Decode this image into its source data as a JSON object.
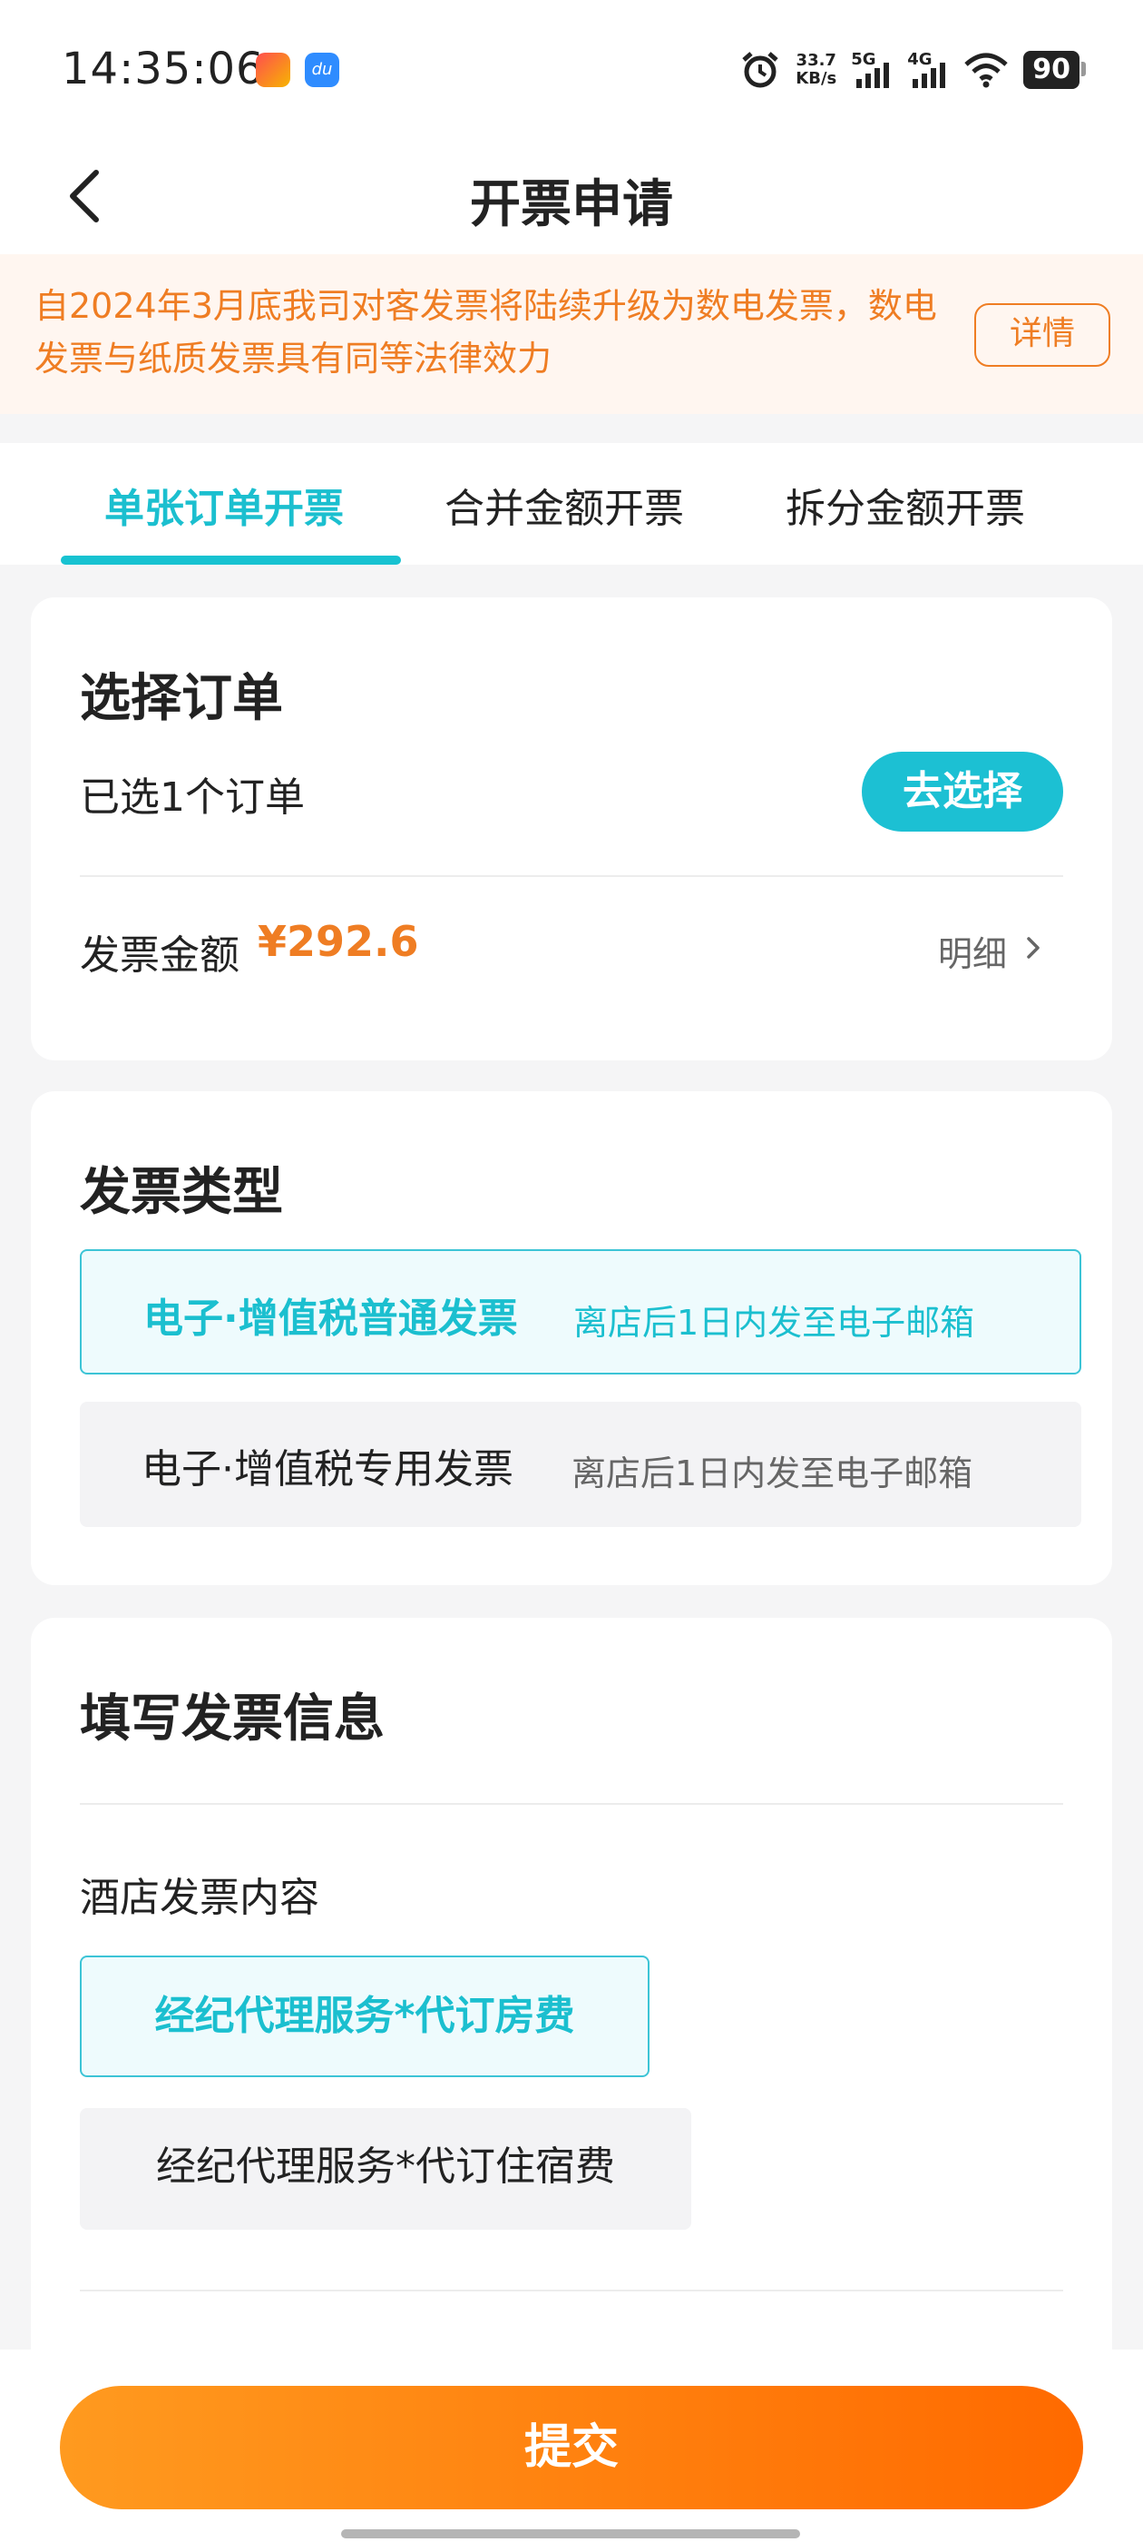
{
  "status_bar": {
    "time": "14:35:06",
    "speed_value": "33.7",
    "speed_unit": "KB/s",
    "net1": "5G",
    "net2": "4G",
    "battery": "90"
  },
  "nav": {
    "title": "开票申请",
    "back_icon": "chevron-left-icon"
  },
  "notice": {
    "text": "自2024年3月底我司对客发票将陆续升级为数电发票，数电发票与纸质发票具有同等法律效力",
    "button": "详情"
  },
  "tabs": [
    {
      "label": "单张订单开票",
      "active": true
    },
    {
      "label": "合并金额开票",
      "active": false
    },
    {
      "label": "拆分金额开票",
      "active": false
    }
  ],
  "order_card": {
    "title": "选择订单",
    "selected_text": "已选1个订单",
    "choose_button": "去选择",
    "amount_label": "发票金额",
    "amount_value": "¥292.6",
    "detail_link": "明细"
  },
  "invoice_type_card": {
    "title": "发票类型",
    "options": [
      {
        "name": "电子·增值税普通发票",
        "desc": "离店后1日内发至电子邮箱",
        "selected": true
      },
      {
        "name": "电子·增值税专用发票",
        "desc": "离店后1日内发至电子邮箱",
        "selected": false
      }
    ]
  },
  "info_card": {
    "title": "填写发票信息",
    "content_label": "酒店发票内容",
    "content_options": [
      {
        "label": "经纪代理服务*代订房费",
        "selected": true
      },
      {
        "label": "经纪代理服务*代订住宿费",
        "selected": false
      }
    ]
  },
  "submit_button": "提交",
  "colors": {
    "accent": "#1bbfcf",
    "orange": "#ef7d23",
    "submit_start": "#ff9a1f",
    "submit_end": "#ff6a00"
  }
}
